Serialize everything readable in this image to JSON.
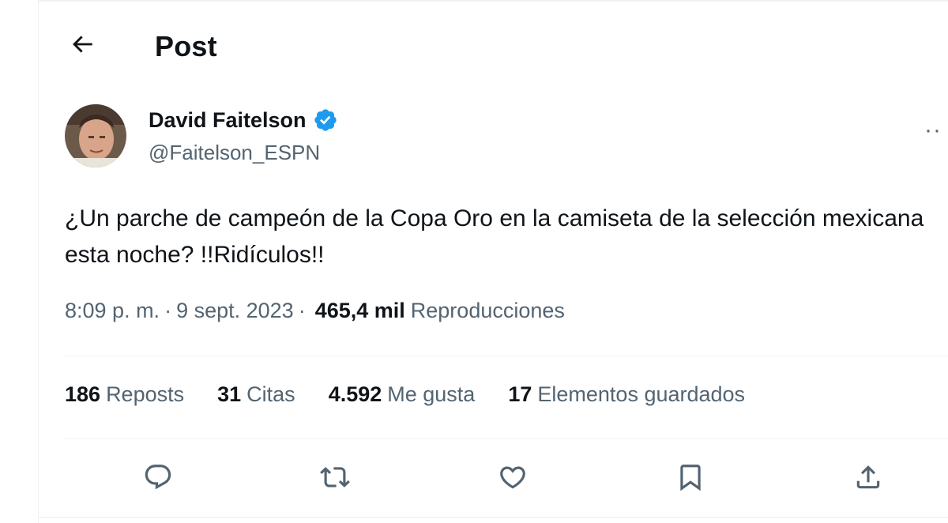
{
  "header": {
    "title": "Post",
    "back_icon": "arrow-left-icon"
  },
  "tweet": {
    "author": {
      "display_name": "David Faitelson",
      "handle": "@Faitelson_ESPN",
      "verified_icon": "verified-badge-icon",
      "verified_color": "#1d9bf0"
    },
    "text": "¿Un parche de campeón de la Copa Oro en la camiseta de la selección mexicana esta noche? !!Ridículos!!",
    "time": "8:09 p. m.",
    "date": "9 sept. 2023",
    "separator": "·",
    "views_count": "465,4 mil",
    "views_label": "Reproducciones",
    "more_icon": "more-horizontal-icon",
    "more_label": "··"
  },
  "stats": [
    {
      "count": "186",
      "label": "Reposts"
    },
    {
      "count": "31",
      "label": "Citas"
    },
    {
      "count": "4.592",
      "label": "Me gusta"
    },
    {
      "count": "17",
      "label": "Elementos guardados"
    }
  ],
  "actions": [
    "reply-icon",
    "repost-icon",
    "like-icon",
    "bookmark-icon",
    "share-icon"
  ],
  "colors": {
    "text": "#0f1419",
    "secondary": "#536471",
    "border": "#eff3f4",
    "accent": "#1d9bf0"
  }
}
